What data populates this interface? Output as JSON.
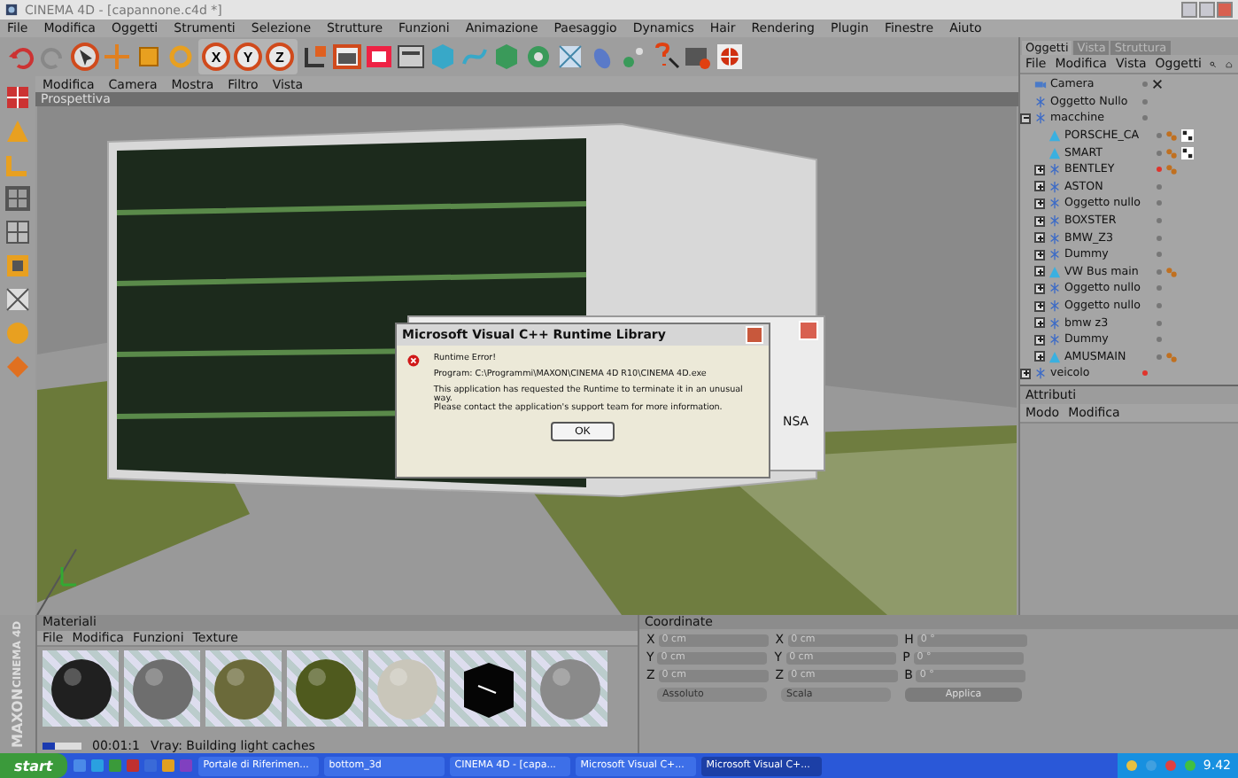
{
  "window": {
    "title": "CINEMA 4D - [capannone.c4d *]"
  },
  "menu": [
    "File",
    "Modifica",
    "Oggetti",
    "Strumenti",
    "Selezione",
    "Strutture",
    "Funzioni",
    "Animazione",
    "Paesaggio",
    "Dynamics",
    "Hair",
    "Rendering",
    "Plugin",
    "Finestre",
    "Aiuto"
  ],
  "toolbar": {
    "axis_buttons": [
      {
        "label": "X",
        "selected": true
      },
      {
        "label": "Y",
        "selected": true
      },
      {
        "label": "Z",
        "selected": true
      }
    ]
  },
  "viewport": {
    "menu": [
      "Modifica",
      "Camera",
      "Mostra",
      "Filtro",
      "Vista"
    ],
    "label": "Prospettiva"
  },
  "background_dialog": {
    "text": "NSA"
  },
  "error_dialog": {
    "title": "Microsoft Visual C++ Runtime Library",
    "heading": "Runtime Error!",
    "program": "Program: C:\\Programmi\\MAXON\\CINEMA 4D R10\\CINEMA 4D.exe",
    "message": [
      "This application has requested the Runtime to terminate it in an unusual way.",
      "Please contact the application's support team for more information."
    ],
    "button": "OK"
  },
  "object_manager": {
    "tabs": [
      {
        "label": "Oggetti",
        "selected": true
      },
      {
        "label": "Vista",
        "selected": false
      },
      {
        "label": "Struttura",
        "selected": false
      }
    ],
    "menu": [
      "File",
      "Modifica",
      "Vista",
      "Oggetti"
    ],
    "objects": [
      {
        "name": "Camera",
        "kind": "camera",
        "hidden": false,
        "tags": [
          {
            "kind": "target"
          }
        ]
      },
      {
        "name": "Oggetto Nullo",
        "kind": "null",
        "hidden": false
      },
      {
        "name": "macchine",
        "kind": "null",
        "hidden": false,
        "expanded": true,
        "children": [
          {
            "name": "PORSCHE_CA",
            "kind": "mesh",
            "hidden": false,
            "tags": [
              {
                "kind": "material"
              },
              {
                "kind": "texture"
              }
            ]
          },
          {
            "name": "SMART",
            "kind": "mesh",
            "hidden": false,
            "tags": [
              {
                "kind": "material"
              },
              {
                "kind": "texture"
              }
            ]
          },
          {
            "name": "BENTLEY",
            "kind": "null",
            "hidden": true,
            "tags": [
              {
                "kind": "material"
              }
            ],
            "expanded": false
          },
          {
            "name": "ASTON",
            "kind": "null",
            "hidden": false,
            "expanded": false
          },
          {
            "name": "Oggetto nullo",
            "kind": "null",
            "hidden": false,
            "expanded": false
          },
          {
            "name": "BOXSTER",
            "kind": "null",
            "hidden": false,
            "expanded": false
          },
          {
            "name": "BMW_Z3",
            "kind": "null",
            "hidden": false,
            "expanded": false
          },
          {
            "name": "Dummy",
            "kind": "null",
            "hidden": false,
            "expanded": false
          },
          {
            "name": "VW Bus main",
            "kind": "mesh",
            "hidden": false,
            "tags": [
              {
                "kind": "material"
              }
            ],
            "expanded": false
          },
          {
            "name": "Oggetto nullo",
            "kind": "null",
            "hidden": false,
            "expanded": false
          },
          {
            "name": "Oggetto nullo",
            "kind": "null",
            "hidden": false,
            "expanded": false
          },
          {
            "name": "bmw z3",
            "kind": "null",
            "hidden": false,
            "expanded": false
          },
          {
            "name": "Dummy",
            "kind": "null",
            "hidden": false,
            "expanded": false
          },
          {
            "name": "AMUSMAIN",
            "kind": "mesh",
            "hidden": false,
            "tags": [
              {
                "kind": "material"
              }
            ],
            "expanded": false
          }
        ]
      },
      {
        "name": "veicolo",
        "kind": "null",
        "hidden": true,
        "expanded": false
      }
    ]
  },
  "attribute_manager": {
    "title": "Attributi",
    "menu": [
      "Modo",
      "Modifica"
    ]
  },
  "material_manager": {
    "title": "Materiali",
    "menu": [
      "File",
      "Modifica",
      "Funzioni",
      "Texture"
    ],
    "materials": [
      {
        "kind": "sphere",
        "color": "#202020"
      },
      {
        "kind": "sphere",
        "color": "#6e6e6e"
      },
      {
        "kind": "sphere",
        "color": "#6b6a3a"
      },
      {
        "kind": "sphere",
        "color": "#4f5a1e"
      },
      {
        "kind": "sphere",
        "color": "#c9c6ba"
      },
      {
        "kind": "cube",
        "color": "#050505"
      },
      {
        "kind": "sphere",
        "color": "#8a8a8a"
      }
    ]
  },
  "status": {
    "level": 0.3,
    "time": "00:01:1",
    "message": "Vray: Building light caches"
  },
  "coordinates": {
    "title": "Coordinate",
    "rows": [
      {
        "labels": [
          "X",
          "X",
          "H"
        ],
        "values": [
          "0 cm",
          "0 cm",
          "0 °"
        ]
      },
      {
        "labels": [
          "Y",
          "Y",
          "P"
        ],
        "values": [
          "0 cm",
          "0 cm",
          "0 °"
        ]
      },
      {
        "labels": [
          "Z",
          "Z",
          "B"
        ],
        "values": [
          "0 cm",
          "0 cm",
          "0 °"
        ]
      }
    ],
    "dropdowns": [
      "Assoluto",
      "Scala"
    ],
    "apply": "Applica"
  },
  "logo": {
    "brand": "MAXON",
    "product": "CINEMA 4D"
  },
  "taskbar": {
    "start": "start",
    "tasks": [
      {
        "label": "Portale di Riferimen...",
        "selected": false
      },
      {
        "label": "bottom_3d",
        "selected": false
      },
      {
        "label": "CINEMA 4D - [capa...",
        "selected": false
      },
      {
        "label": "Microsoft Visual C+...",
        "selected": false
      },
      {
        "label": "Microsoft Visual C+...",
        "selected": true
      }
    ],
    "clock": "9.42"
  }
}
